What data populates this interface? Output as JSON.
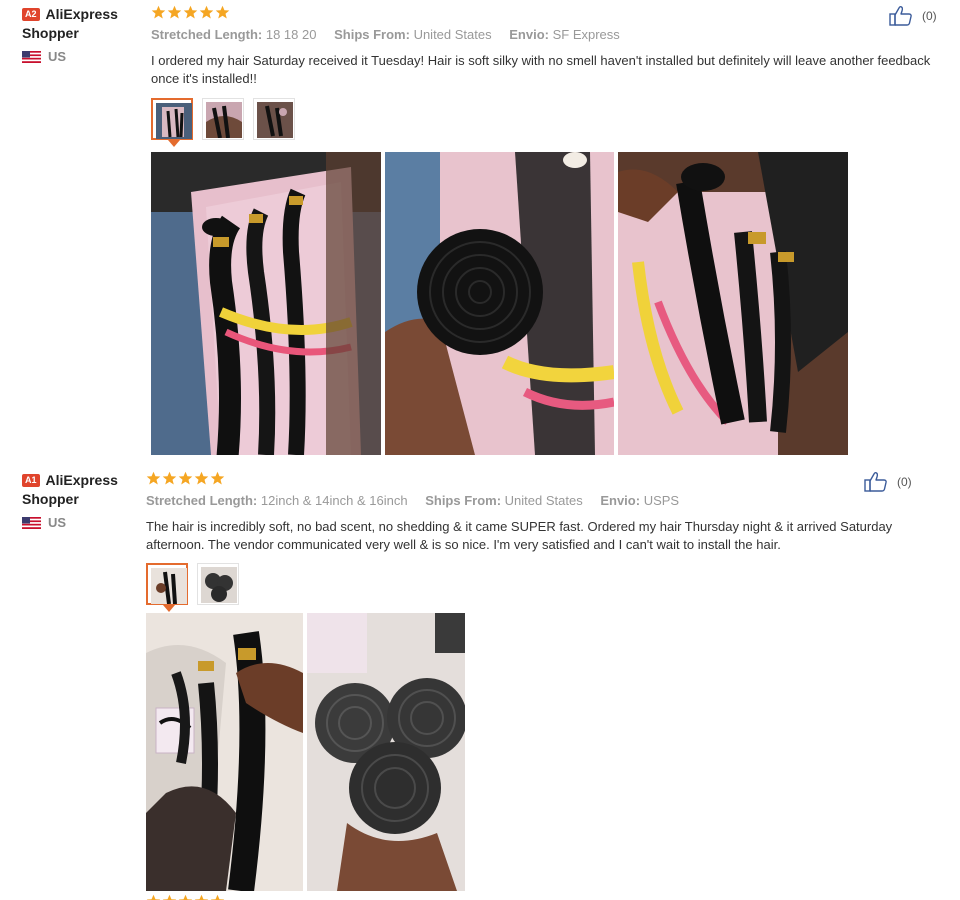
{
  "reviews": [
    {
      "badge": "A2",
      "user": "AliExpress Shopper",
      "country": "US",
      "rating": 5,
      "specs": {
        "length_label": "Stretched Length:",
        "length_value": "18 18 20",
        "ships_label": "Ships From:",
        "ships_value": "United States",
        "envio_label": "Envio:",
        "envio_value": "SF Express"
      },
      "helpful_count": "(0)",
      "text": "I ordered my hair Saturday received it Tuesday! Hair is soft silky with no smell haven't installed but definitely will leave another feedback once it's installed!!",
      "thumbnails": 3,
      "photos": [
        "pink-bag-bundles-photo",
        "hair-roll-in-hand-photo",
        "bundles-held-photo"
      ]
    },
    {
      "badge": "A1",
      "user": "AliExpress Shopper",
      "country": "US",
      "rating": 5,
      "specs": {
        "length_label": "Stretched Length:",
        "length_value": "12inch & 14inch & 16inch",
        "ships_label": "Ships From:",
        "ships_value": "United States",
        "envio_label": "Envio:",
        "envio_value": "USPS"
      },
      "helpful_count": "(0)",
      "text": "The hair is incredibly soft, no bad scent, no shedding & it came SUPER fast. Ordered my hair Thursday night & it arrived Saturday afternoon. The vendor communicated very well & is so nice. I'm very satisfied and I can't wait to install the hair.",
      "thumbnails": 2,
      "photos": [
        "straight-hair-held-photo",
        "three-rolls-photo"
      ]
    }
  ],
  "colors": {
    "star": "#f5a623",
    "accent": "#e46b2e",
    "badge": "#e0442c",
    "like_icon": "#3b5b9a"
  },
  "icons": {
    "like": "thumbs-up-icon",
    "flag": "us-flag-icon",
    "star": "star-icon"
  }
}
